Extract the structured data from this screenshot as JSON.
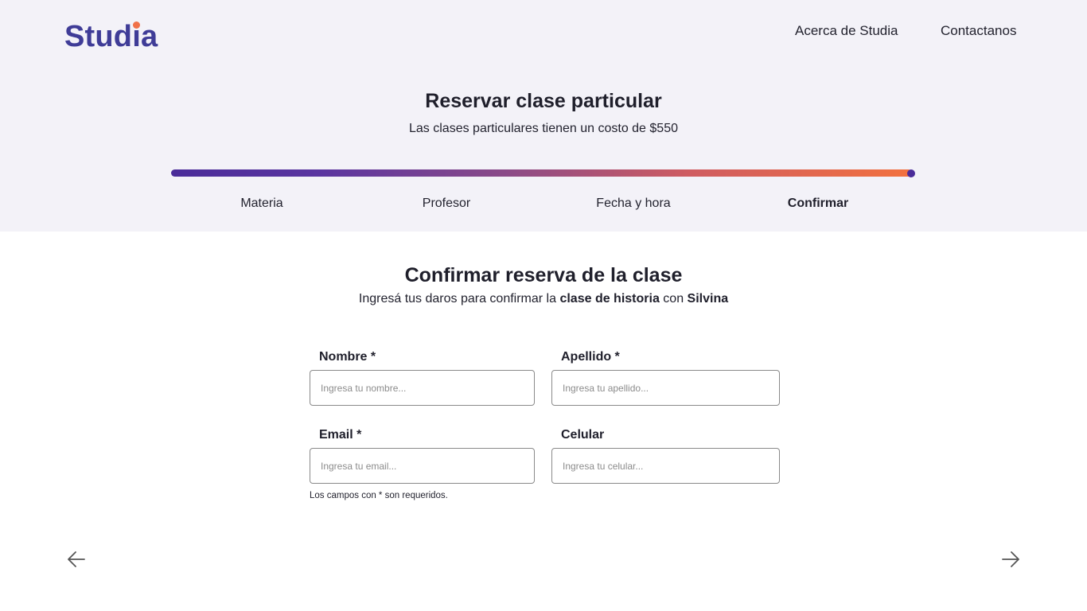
{
  "brand": {
    "logo_prefix": "Stud",
    "logo_i": "ı",
    "logo_suffix": "a",
    "primary_color": "#3f3c97",
    "accent_color": "#f07149"
  },
  "nav": {
    "about": "Acerca de Studia",
    "contact": "Contactanos"
  },
  "header": {
    "title": "Reservar clase particular",
    "subtitle": "Las clases particulares tienen un costo de $550"
  },
  "progress": {
    "fraction": 1.0,
    "gradient_start": "#4a2c99",
    "gradient_end": "#f2713f",
    "steps": [
      "Materia",
      "Profesor",
      "Fecha y hora",
      "Confirmar"
    ],
    "active_step": "Confirmar"
  },
  "confirm": {
    "title": "Confirmar reserva de la clase",
    "sub_prefix": "Ingresá tus daros para confirmar la ",
    "subject": "clase de historia",
    "sub_middle": " con ",
    "teacher": "Silvina"
  },
  "form": {
    "nombre": {
      "label": "Nombre *",
      "placeholder": "Ingresa tu nombre..."
    },
    "apellido": {
      "label": "Apellido *",
      "placeholder": "Ingresa tu apellido..."
    },
    "email": {
      "label": "Email *",
      "placeholder": "Ingresa tu email..."
    },
    "celular": {
      "label": "Celular",
      "placeholder": "Ingresa tu celular..."
    },
    "note": "Los campos con * son requeridos."
  },
  "icons": {
    "prev": "arrow-left-icon",
    "next": "arrow-right-icon"
  }
}
